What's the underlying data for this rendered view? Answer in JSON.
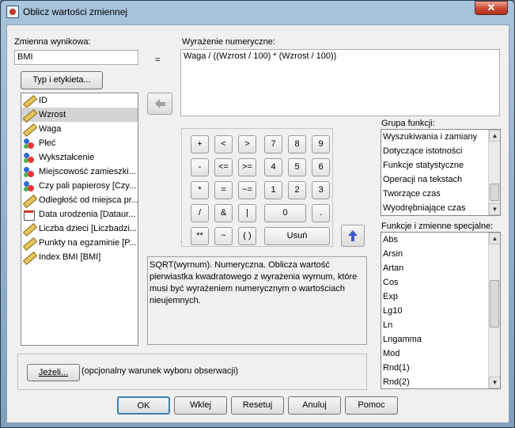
{
  "window": {
    "title": "Oblicz wartości zmiennej",
    "close_glyph": "✕"
  },
  "target": {
    "label": "Zmienna wynikowa:",
    "value": "BMI",
    "type_button": "Typ i etykieta..."
  },
  "equals": "=",
  "expression": {
    "label": "Wyrażenie numeryczne:",
    "value": "Waga / ((Wzrost / 100) * (Wzrost / 100))"
  },
  "variables": [
    {
      "label": "ID",
      "icon": "ruler-icon",
      "selected": false
    },
    {
      "label": "Wzrost",
      "icon": "ruler-icon",
      "selected": true
    },
    {
      "label": "Waga",
      "icon": "ruler-icon",
      "selected": false
    },
    {
      "label": "Płeć",
      "icon": "nominal-icon",
      "selected": false
    },
    {
      "label": "Wykształcenie",
      "icon": "nominal-icon",
      "selected": false
    },
    {
      "label": "Miejscowość zamieszki...",
      "icon": "nominal-icon",
      "selected": false
    },
    {
      "label": "Czy pali papierosy [Czy...",
      "icon": "nominal-icon",
      "selected": false
    },
    {
      "label": "Odległość od miejsca pr...",
      "icon": "ruler-icon",
      "selected": false
    },
    {
      "label": "Data urodzenia [Dataur...",
      "icon": "date-icon",
      "selected": false
    },
    {
      "label": "Liczba dzieci [Liczbadzi...",
      "icon": "ruler-icon",
      "selected": false
    },
    {
      "label": "Punkty na egzaminie [P...",
      "icon": "ruler-icon",
      "selected": false
    },
    {
      "label": "Index BMI [BMI]",
      "icon": "ruler-icon",
      "selected": false
    }
  ],
  "keypad": {
    "row1": [
      "+",
      "<",
      ">",
      "7",
      "8",
      "9"
    ],
    "row2": [
      "-",
      "<=",
      ">=",
      "4",
      "5",
      "6"
    ],
    "row3": [
      "*",
      "=",
      "~=",
      "1",
      "2",
      "3"
    ],
    "row4": [
      "/",
      "&",
      "|",
      "0",
      "."
    ],
    "row5": [
      "**",
      "~",
      "( )",
      "Usuń"
    ]
  },
  "function_group": {
    "label": "Grupa funkcji:",
    "items": [
      "Wyszukiwania i zamiany",
      "Dotyczące istotności",
      "Funkcje statystyczne",
      "Operacji na tekstach",
      "Tworzące czas",
      "Wyodrębniające czas"
    ]
  },
  "special_functions": {
    "label": "Funkcje i zmienne specjalne:",
    "items": [
      "Abs",
      "Arsin",
      "Artan",
      "Cos",
      "Exp",
      "Lg10",
      "Ln",
      "Lngamma",
      "Mod",
      "Rnd(1)",
      "Rnd(2)"
    ]
  },
  "description": "SQRT(wyrnum). Numeryczna. Oblicza wartość pierwiastka kwadratowego z wyrażenia wyrnum, które musi być wyrażeniem numerycznym o wartościach nieujemnych.",
  "condition": {
    "button": "Jeżeli...",
    "text": "(opcjonalny warunek wyboru obserwacji)"
  },
  "buttons": {
    "ok": "OK",
    "paste": "Wklej",
    "reset": "Resetuj",
    "cancel": "Anuluj",
    "help": "Pomoc"
  }
}
